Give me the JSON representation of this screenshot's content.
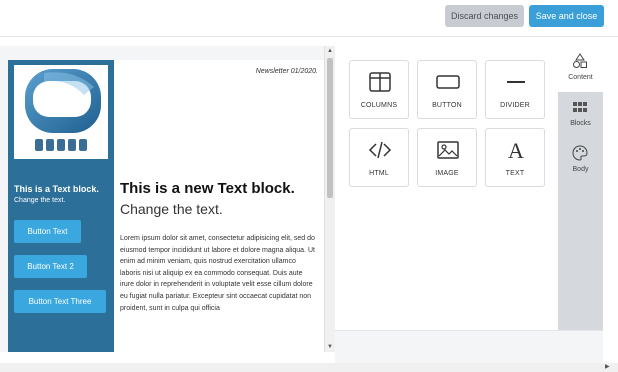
{
  "toolbar": {
    "discard_label": "Discard changes",
    "save_label": "Save and close"
  },
  "email": {
    "newsletter": "Newsletter 01/2020.",
    "sidebar": {
      "title": "This is a Text block.",
      "subtitle": "Change the text.",
      "buttons": [
        "Button Text",
        "Button Text 2",
        "Button Text Three"
      ]
    },
    "main": {
      "title": "This is a new Text block.",
      "subtitle": "Change the text.",
      "body": "Lorem ipsum dolor sit amet, consectetur adipisicing elit, sed do eiusmod tempor incididunt ut labore et dolore magna aliqua. Ut enim ad minim veniam, quis nostrud exercitation ullamco laboris nisi ut aliquip ex ea commodo consequat. Duis aute irure dolor in reprehenderit in voluptate velit esse cillum dolore eu fugiat nulla pariatur. Excepteur sint occaecat cupidatat non proident, sunt in culpa qui officia"
    }
  },
  "blocks": [
    {
      "label": "COLUMNS",
      "icon": "columns-icon"
    },
    {
      "label": "BUTTON",
      "icon": "button-icon"
    },
    {
      "label": "DIVIDER",
      "icon": "divider-icon"
    },
    {
      "label": "HTML",
      "icon": "code-icon"
    },
    {
      "label": "IMAGE",
      "icon": "image-icon"
    },
    {
      "label": "TEXT",
      "icon": "text-icon"
    }
  ],
  "tabs": [
    {
      "label": "Content",
      "icon": "shapes-icon",
      "active": true
    },
    {
      "label": "Blocks",
      "icon": "grid-icon",
      "active": false
    },
    {
      "label": "Body",
      "icon": "palette-icon",
      "active": false
    }
  ],
  "colors": {
    "accent": "#3a9fd8",
    "email_sidebar": "#2c6f99",
    "email_button": "#3aa7df"
  }
}
